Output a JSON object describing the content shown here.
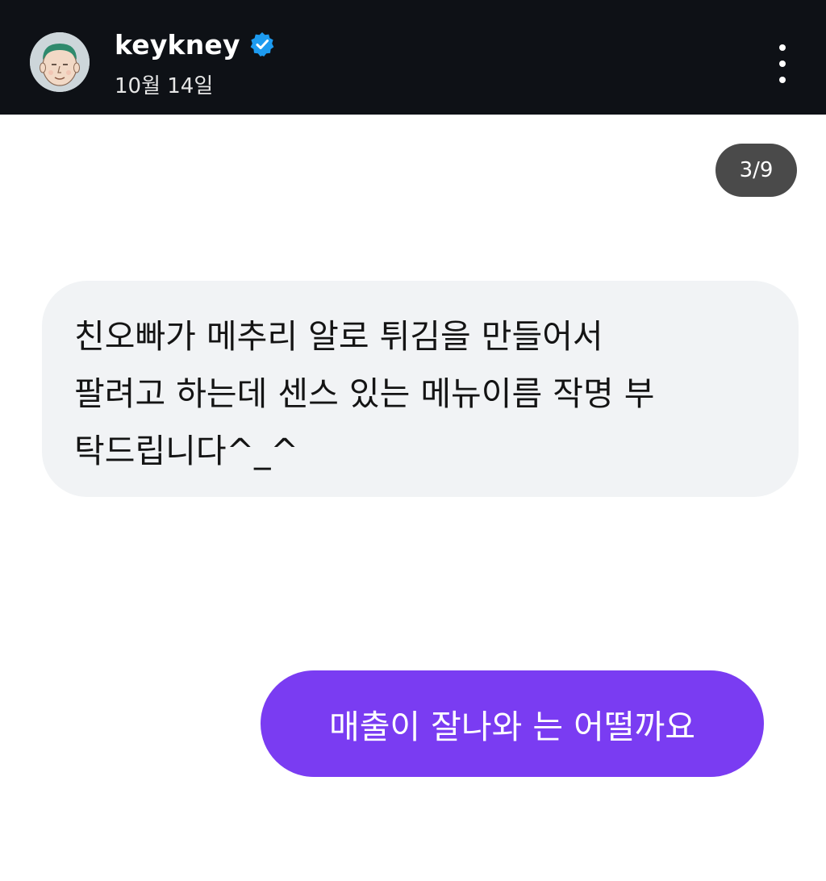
{
  "header": {
    "username": "keykney",
    "date": "10월 14일",
    "verified": true,
    "avatar_icon": "cartoon-face-avatar",
    "more_icon": "vertical-ellipsis-icon",
    "verified_icon": "verified-badge-icon"
  },
  "media": {
    "counter": "3/9"
  },
  "messages": [
    {
      "direction": "incoming",
      "lines": [
        "친오빠가 메추리 알로 튀김을 만들어서",
        "팔려고 하는데 센스 있는 메뉴이름 작명 부",
        "탁드립니다^_^"
      ]
    },
    {
      "direction": "outgoing",
      "text": "매출이 잘나와 는 어떨까요"
    }
  ],
  "colors": {
    "header_bg": "#0e1116",
    "verified_blue": "#1d9bf0",
    "counter_bg": "#4a4a4a",
    "incoming_bubble": "#f1f3f5",
    "outgoing_bubble": "#7a3cf2"
  }
}
